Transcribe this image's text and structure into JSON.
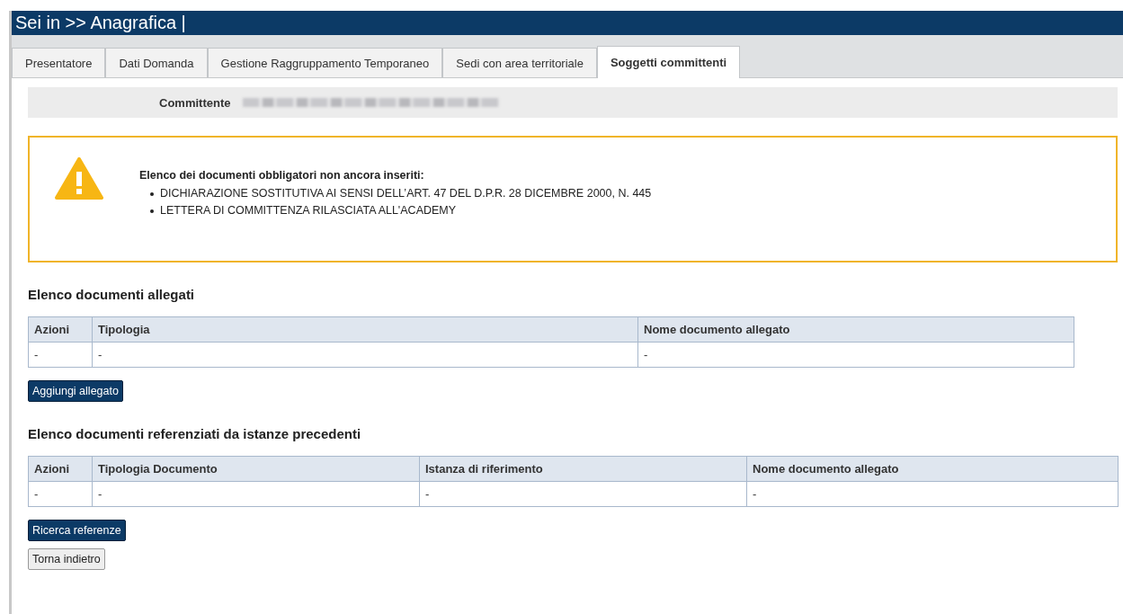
{
  "header": {
    "title": "Sei in >> Anagrafica |"
  },
  "tabs": [
    {
      "label": "Presentatore",
      "selected": false
    },
    {
      "label": "Dati Domanda",
      "selected": false
    },
    {
      "label": "Gestione Raggruppamento Temporaneo",
      "selected": false
    },
    {
      "label": "Sedi con area territoriale",
      "selected": false
    },
    {
      "label": "Soggetti committenti",
      "selected": true
    }
  ],
  "committente": {
    "label": "Committente"
  },
  "warning": {
    "title": "Elenco dei documenti obbligatori non ancora inseriti:",
    "items": [
      "DICHIARAZIONE SOSTITUTIVA AI SENSI DELL’ART. 47 DEL D.P.R. 28 DICEMBRE 2000, N. 445",
      "LETTERA DI COMMITTENZA RILASCIATA ALL'ACADEMY"
    ]
  },
  "attached": {
    "title": "Elenco documenti allegati",
    "columns": [
      "Azioni",
      "Tipologia",
      "Nome documento allegato"
    ],
    "rows": [
      [
        "-",
        "-",
        "-"
      ]
    ],
    "button": "Aggiungi allegato"
  },
  "referenced": {
    "title": "Elenco documenti referenziati da istanze precedenti",
    "columns": [
      "Azioni",
      "Tipologia Documento",
      "Istanza di riferimento",
      "Nome documento allegato"
    ],
    "rows": [
      [
        "-",
        "-",
        "-",
        "-"
      ]
    ],
    "button": "Ricerca referenze"
  },
  "back_button": "Torna indietro"
}
